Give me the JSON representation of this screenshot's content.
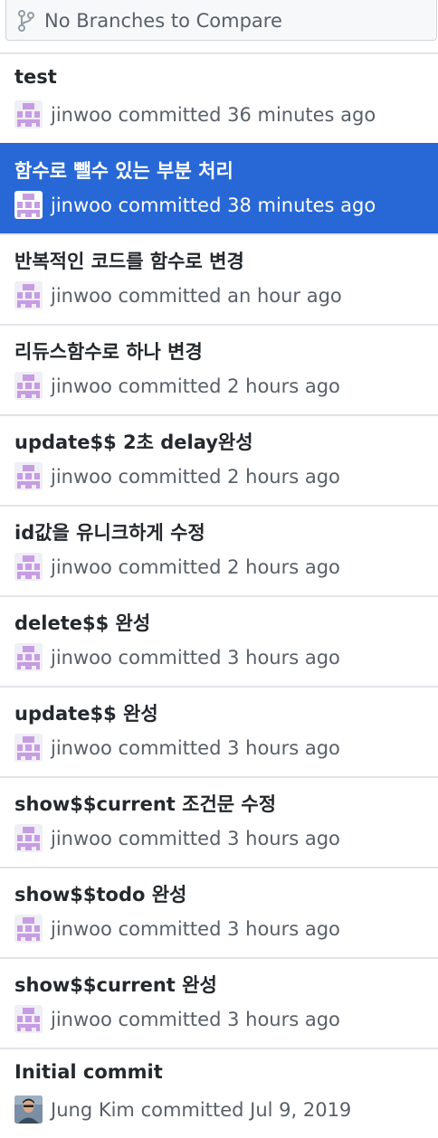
{
  "compare": {
    "label": "No Branches to Compare",
    "icon": "git-branch-icon"
  },
  "colors": {
    "selected_bg": "#2868d6",
    "identicon": "#c69ce3"
  },
  "commits": [
    {
      "summary": "test",
      "author": "jinwoo",
      "verb": "committed",
      "time": "36 minutes ago",
      "avatar": "identicon-avatar"
    },
    {
      "summary": "함수로 뺄수 있는 부분 처리",
      "author": "jinwoo",
      "verb": "committed",
      "time": "38 minutes ago",
      "avatar": "identicon-avatar",
      "selected": true
    },
    {
      "summary": "반복적인 코드를 함수로 변경",
      "author": "jinwoo",
      "verb": "committed",
      "time": "an hour ago",
      "avatar": "identicon-avatar"
    },
    {
      "summary": "리듀스함수로 하나 변경",
      "author": "jinwoo",
      "verb": "committed",
      "time": "2 hours ago",
      "avatar": "identicon-avatar"
    },
    {
      "summary": "update$$ 2초 delay완성",
      "author": "jinwoo",
      "verb": "committed",
      "time": "2 hours ago",
      "avatar": "identicon-avatar"
    },
    {
      "summary": "id값을 유니크하게 수정",
      "author": "jinwoo",
      "verb": "committed",
      "time": "2 hours ago",
      "avatar": "identicon-avatar"
    },
    {
      "summary": "delete$$ 완성",
      "author": "jinwoo",
      "verb": "committed",
      "time": "3 hours ago",
      "avatar": "identicon-avatar"
    },
    {
      "summary": "update$$ 완성",
      "author": "jinwoo",
      "verb": "committed",
      "time": "3 hours ago",
      "avatar": "identicon-avatar"
    },
    {
      "summary": "show$$current 조건문 수정",
      "author": "jinwoo",
      "verb": "committed",
      "time": "3 hours ago",
      "avatar": "identicon-avatar"
    },
    {
      "summary": "show$$todo 완성",
      "author": "jinwoo",
      "verb": "committed",
      "time": "3 hours ago",
      "avatar": "identicon-avatar"
    },
    {
      "summary": "show$$current 완성",
      "author": "jinwoo",
      "verb": "committed",
      "time": "3 hours ago",
      "avatar": "identicon-avatar"
    },
    {
      "summary": "Initial commit",
      "author": "Jung Kim",
      "verb": "committed",
      "time": "Jul 9, 2019",
      "avatar": "photo-avatar"
    }
  ]
}
